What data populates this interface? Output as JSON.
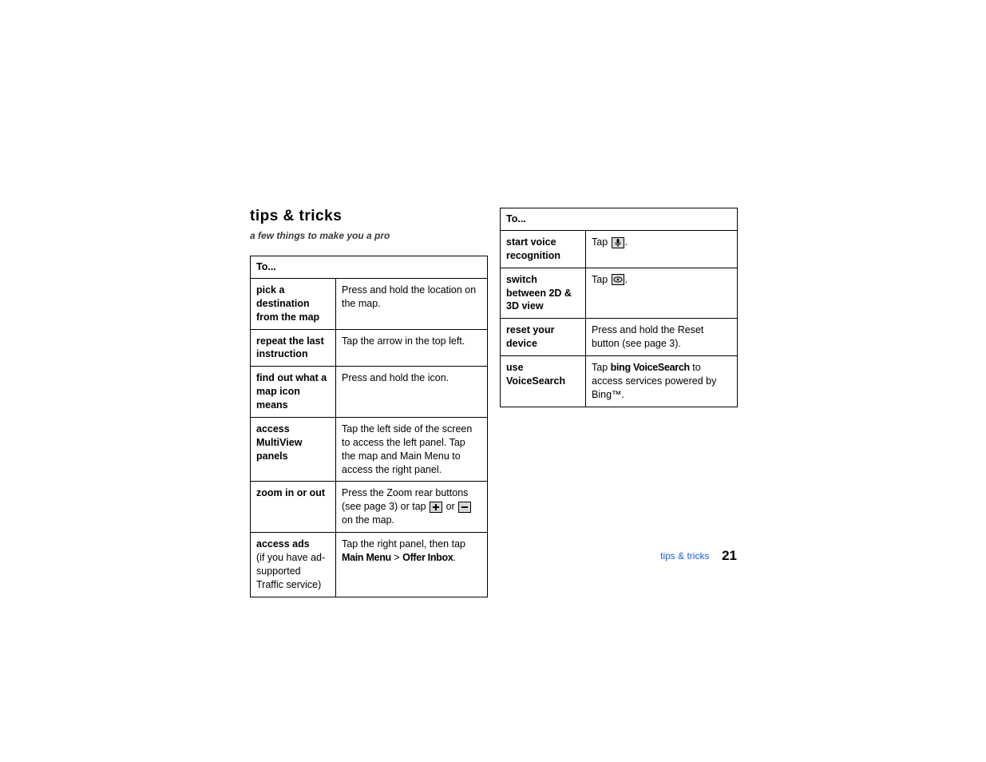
{
  "heading": "tips & tricks",
  "subtitle": "a few things to make you a pro",
  "leftTable": {
    "header": "To...",
    "rows": [
      {
        "action_bold": "pick a destination from the map",
        "action_sub": "",
        "desc_parts": [
          {
            "t": "text",
            "v": "Press and hold the location on the map."
          }
        ]
      },
      {
        "action_bold": "repeat the last instruction",
        "action_sub": "",
        "desc_parts": [
          {
            "t": "text",
            "v": "Tap the arrow in the top left."
          }
        ]
      },
      {
        "action_bold": "find out what a map icon means",
        "action_sub": "",
        "desc_parts": [
          {
            "t": "text",
            "v": "Press and hold the icon."
          }
        ]
      },
      {
        "action_bold": "access MultiView panels",
        "action_sub": "",
        "desc_parts": [
          {
            "t": "text",
            "v": "Tap the left side of the screen to access the left panel. Tap the map and Main Menu to access the right panel."
          }
        ]
      },
      {
        "action_bold": "zoom in or out",
        "action_sub": "",
        "desc_parts": [
          {
            "t": "text",
            "v": "Press the Zoom rear buttons (see page 3) or tap "
          },
          {
            "t": "icon",
            "v": "plus"
          },
          {
            "t": "text",
            "v": " or "
          },
          {
            "t": "icon",
            "v": "minus"
          },
          {
            "t": "text",
            "v": " on the map."
          }
        ]
      },
      {
        "action_bold": "access ads",
        "action_sub": "(if you have ad-supported Traffic service)",
        "desc_parts": [
          {
            "t": "text",
            "v": "Tap the right panel, then tap "
          },
          {
            "t": "ui",
            "v": "Main Menu"
          },
          {
            "t": "text",
            "v": " > "
          },
          {
            "t": "ui",
            "v": "Offer Inbox"
          },
          {
            "t": "text",
            "v": "."
          }
        ]
      }
    ]
  },
  "rightTable": {
    "header": "To...",
    "rows": [
      {
        "action_bold": "start voice recognition",
        "action_sub": "",
        "desc_parts": [
          {
            "t": "text",
            "v": "Tap "
          },
          {
            "t": "icon",
            "v": "mic"
          },
          {
            "t": "text",
            "v": "."
          }
        ]
      },
      {
        "action_bold": "switch between 2D & 3D view",
        "action_sub": "",
        "desc_parts": [
          {
            "t": "text",
            "v": "Tap "
          },
          {
            "t": "icon",
            "v": "eye"
          },
          {
            "t": "text",
            "v": "."
          }
        ]
      },
      {
        "action_bold": "reset your device",
        "action_sub": "",
        "desc_parts": [
          {
            "t": "text",
            "v": "Press and hold the Reset button (see page 3)."
          }
        ]
      },
      {
        "action_bold": "use VoiceSearch",
        "action_sub": "",
        "desc_parts": [
          {
            "t": "text",
            "v": "Tap "
          },
          {
            "t": "ui",
            "v": "bing VoiceSearch"
          },
          {
            "t": "text",
            "v": " to access services powered by Bing™."
          }
        ]
      }
    ]
  },
  "footer": {
    "link": "tips & tricks",
    "page": "21"
  }
}
